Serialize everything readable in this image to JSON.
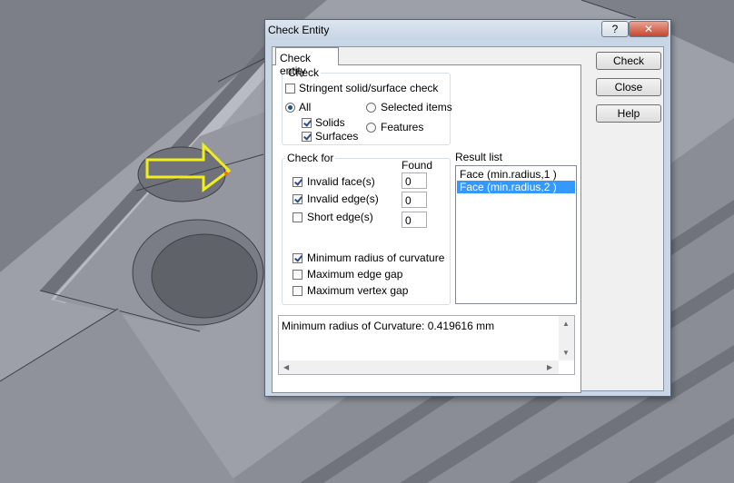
{
  "window": {
    "title": "Check Entity",
    "help_glyph": "?",
    "close_glyph": "✕"
  },
  "tab": {
    "label": "Check entity"
  },
  "check_group": {
    "label": "Check",
    "stringent": {
      "label": "Stringent solid/surface check",
      "checked": false
    },
    "scope_all": {
      "label": "All",
      "selected": true
    },
    "solids": {
      "label": "Solids",
      "checked": true
    },
    "surfaces": {
      "label": "Surfaces",
      "checked": true
    },
    "scope_selected": {
      "label": "Selected items",
      "selected": false
    },
    "scope_features": {
      "label": "Features",
      "selected": false
    }
  },
  "check_for": {
    "label": "Check for",
    "found_header": "Found",
    "invalid_faces": {
      "label": "Invalid face(s)",
      "checked": true,
      "found": "0"
    },
    "invalid_edges": {
      "label": "Invalid edge(s)",
      "checked": true,
      "found": "0"
    },
    "short_edges": {
      "label": "Short edge(s)",
      "checked": false,
      "found": "0"
    },
    "min_radius": {
      "label": "Minimum radius of curvature",
      "checked": true
    },
    "max_edge_gap": {
      "label": "Maximum edge gap",
      "checked": false
    },
    "max_vertex_gap": {
      "label": "Maximum vertex gap",
      "checked": false
    }
  },
  "result_list": {
    "label": "Result list",
    "items": [
      "Face (min.radius,1  )",
      "Face (min.radius,2  )"
    ],
    "selected_index": 1
  },
  "message": {
    "text": "Minimum radius of Curvature: 0.419616 mm"
  },
  "buttons": {
    "check": "Check",
    "close": "Close",
    "help": "Help"
  },
  "colors": {
    "selection": "#3399ff",
    "annotation_arrow": "#f2ee1c"
  }
}
